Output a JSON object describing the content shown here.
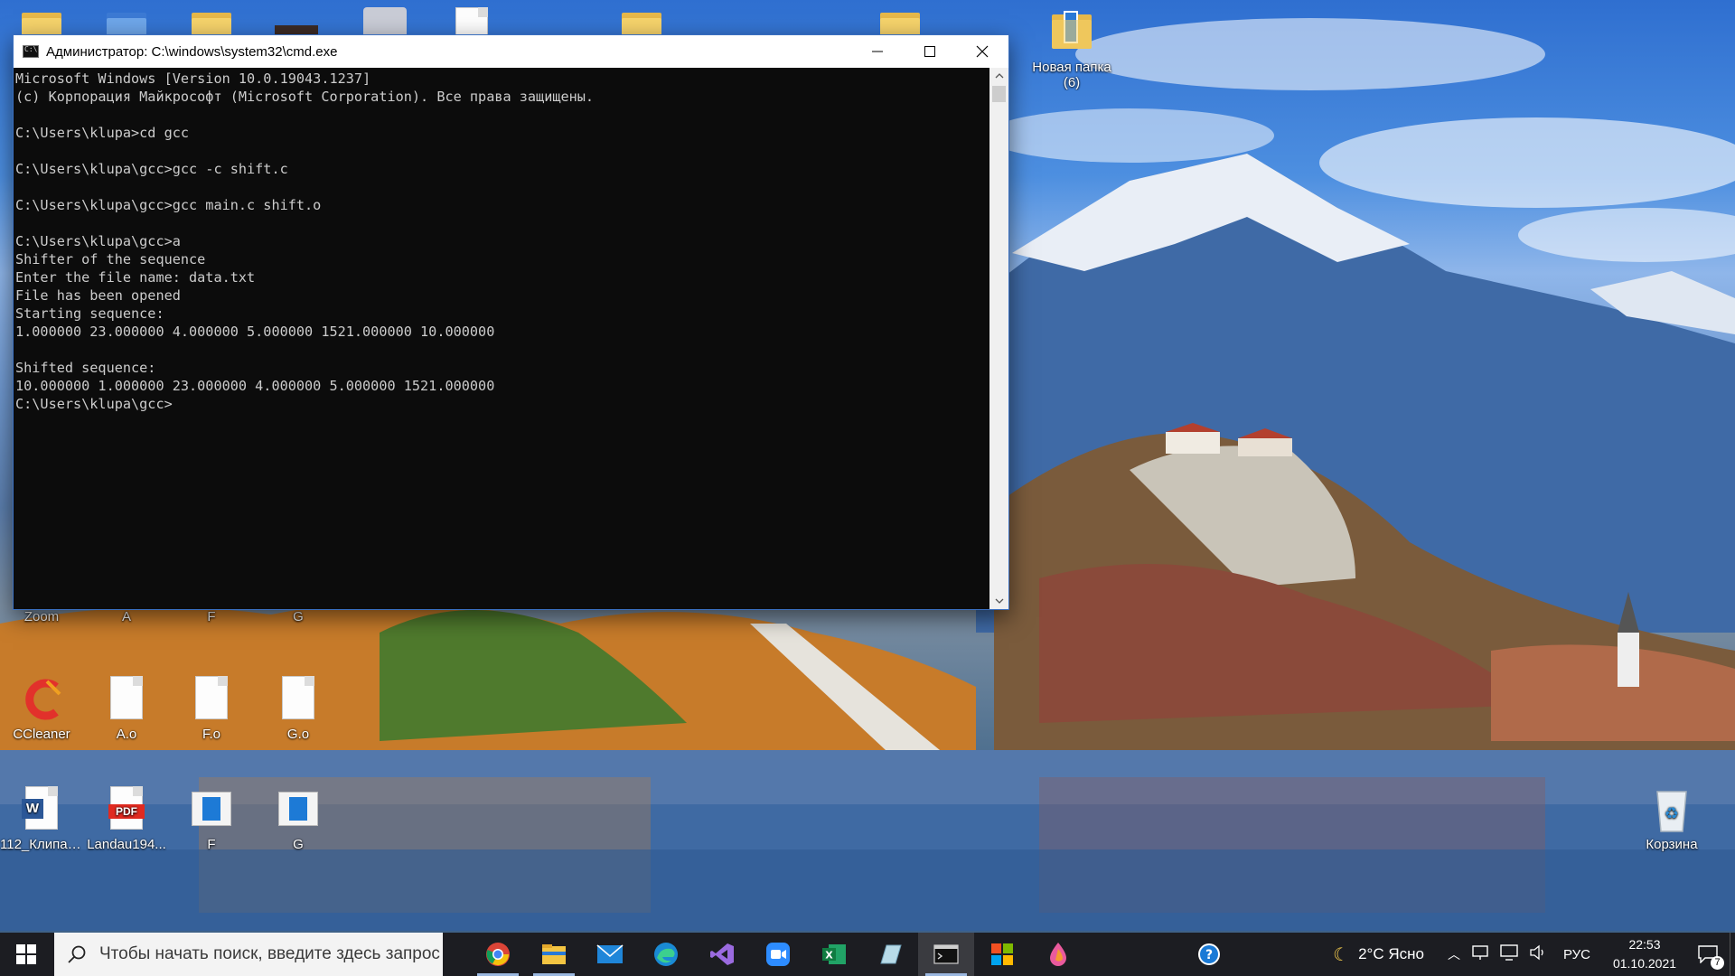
{
  "desktop": {
    "icons_top_right": {
      "label": "Новая папка (6)"
    },
    "row_a": [
      {
        "label": "Zoom"
      },
      {
        "label": "A"
      },
      {
        "label": "F"
      },
      {
        "label": "G"
      }
    ],
    "row_b": [
      {
        "label": "CCleaner"
      },
      {
        "label": "A.o"
      },
      {
        "label": "F.o"
      },
      {
        "label": "G.o"
      }
    ],
    "row_c": [
      {
        "label": "112_Клипал..."
      },
      {
        "label": "Landau194..."
      },
      {
        "label": "F"
      },
      {
        "label": "G"
      }
    ],
    "recycle_bin": {
      "label": "Корзина"
    },
    "pdf_badge": "PDF"
  },
  "window": {
    "title": "Администратор: C:\\windows\\system32\\cmd.exe",
    "console_lines": [
      "Microsoft Windows [Version 10.0.19043.1237]",
      "(c) Корпорация Майкрософт (Microsoft Corporation). Все права защищены.",
      "",
      "C:\\Users\\klupa>cd gcc",
      "",
      "C:\\Users\\klupa\\gcc>gcc -c shift.c",
      "",
      "C:\\Users\\klupa\\gcc>gcc main.c shift.o",
      "",
      "C:\\Users\\klupa\\gcc>a",
      "Shifter of the sequence",
      "Enter the file name: data.txt",
      "File has been opened",
      "Starting sequence:",
      "1.000000 23.000000 4.000000 5.000000 1521.000000 10.000000",
      "",
      "Shifted sequence:",
      "10.000000 1.000000 23.000000 4.000000 5.000000 1521.000000",
      "C:\\Users\\klupa\\gcc>"
    ]
  },
  "taskbar": {
    "search_placeholder": "Чтобы начать поиск, введите здесь запрос",
    "weather": "2°C Ясно",
    "language": "РУС",
    "time": "22:53",
    "date": "01.10.2021",
    "notification_count": "7",
    "apps": [
      {
        "name": "chrome-icon"
      },
      {
        "name": "file-explorer-icon"
      },
      {
        "name": "mail-icon"
      },
      {
        "name": "edge-icon"
      },
      {
        "name": "visual-studio-icon"
      },
      {
        "name": "zoom-icon"
      },
      {
        "name": "excel-icon"
      },
      {
        "name": "notes-icon"
      },
      {
        "name": "cmd-icon"
      },
      {
        "name": "store-icon"
      },
      {
        "name": "paint-drop-icon"
      }
    ]
  },
  "colors": {
    "console_bg": "#0c0c0c",
    "console_text": "#cccccc",
    "taskbar_bg": "#1c1d22",
    "accent": "#3a6fbf"
  }
}
